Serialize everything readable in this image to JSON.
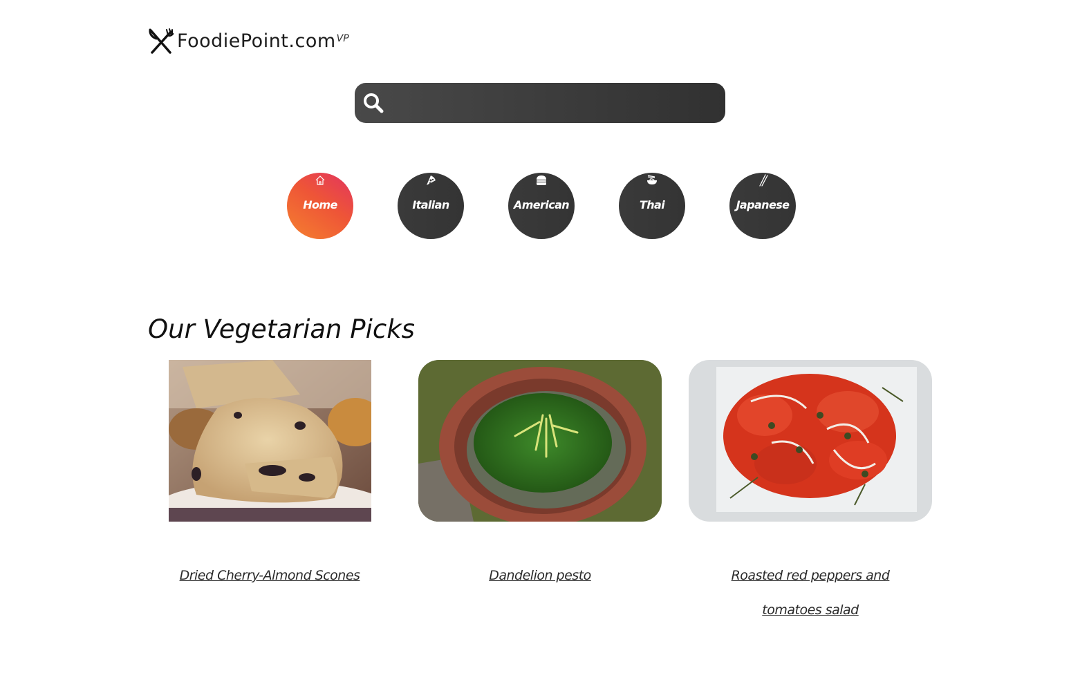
{
  "brand": {
    "name": "FoodiePoint.com",
    "suffix": "VP",
    "logo_icon": "fork-knife-icon"
  },
  "search": {
    "placeholder": "",
    "value": "",
    "icon": "search-icon"
  },
  "categories": [
    {
      "label": "Home",
      "icon": "house-icon",
      "active": true
    },
    {
      "label": "Italian",
      "icon": "pizza-icon",
      "active": false
    },
    {
      "label": "American",
      "icon": "burger-icon",
      "active": false
    },
    {
      "label": "Thai",
      "icon": "noodle-bowl-icon",
      "active": false
    },
    {
      "label": "Japanese",
      "icon": "chopsticks-icon",
      "active": false
    }
  ],
  "colors": {
    "active_gradient": [
      "#f5812f",
      "#e23460"
    ],
    "dark": "#3a3a3a"
  },
  "section": {
    "title": "Our Vegetarian Picks"
  },
  "recipes": [
    {
      "title": "Dried Cherry-Almond Scones"
    },
    {
      "title": "Dandelion pesto"
    },
    {
      "title": "Roasted red peppers and tomatoes salad"
    }
  ]
}
